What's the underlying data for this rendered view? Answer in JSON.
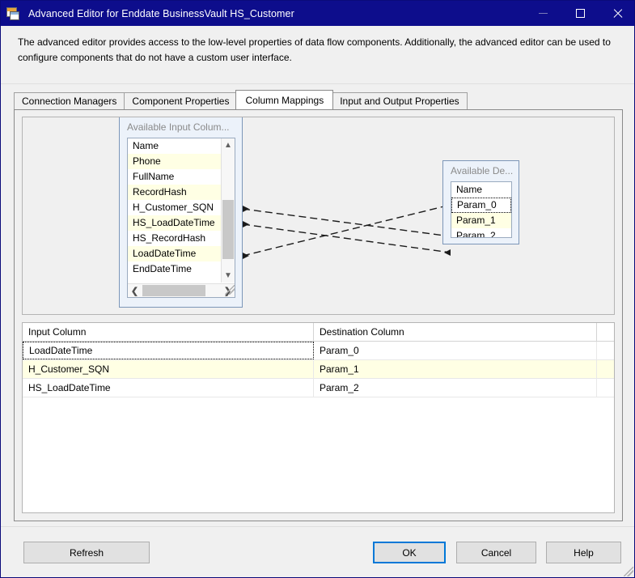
{
  "window": {
    "title": "Advanced Editor for Enddate BusinessVault HS_Customer",
    "icon": "table-component-icon",
    "controls": {
      "minimize": "minimize-icon",
      "maximize": "maximize-icon",
      "close": "close-icon"
    },
    "titlebar_color": "#0d0d8c"
  },
  "description": "The advanced editor provides access to the low-level properties of data flow components. Additionally, the advanced editor can be used to configure components that do not have a custom user interface.",
  "tabs": [
    {
      "label": "Connection Managers",
      "selected": false
    },
    {
      "label": "Component Properties",
      "selected": false
    },
    {
      "label": "Column Mappings",
      "selected": true
    },
    {
      "label": "Input and Output Properties",
      "selected": false
    }
  ],
  "input_list": {
    "title": "Available Input Colum...",
    "header": "Name",
    "items": [
      "Phone",
      "FullName",
      "RecordHash",
      "H_Customer_SQN",
      "HS_LoadDateTime",
      "HS_RecordHash",
      "LoadDateTime",
      "EndDateTime"
    ],
    "vscroll": "vertical-scrollbar",
    "hscroll": "horizontal-scrollbar"
  },
  "destination_list": {
    "title": "Available De...",
    "header": "Name",
    "items": [
      "Param_0",
      "Param_1",
      "Param_2"
    ],
    "focused_item": "Param_0"
  },
  "mappings": [
    {
      "from": "H_Customer_SQN",
      "to": "Param_1"
    },
    {
      "from": "HS_LoadDateTime",
      "to": "Param_2"
    },
    {
      "from": "LoadDateTime",
      "to": "Param_0"
    }
  ],
  "grid": {
    "columns": [
      "Input Column",
      "Destination Column"
    ],
    "rows": [
      {
        "input": "LoadDateTime",
        "destination": "Param_0",
        "focused": true
      },
      {
        "input": "H_Customer_SQN",
        "destination": "Param_1",
        "focused": false
      },
      {
        "input": "HS_LoadDateTime",
        "destination": "Param_2",
        "focused": false
      }
    ]
  },
  "footer": {
    "refresh": "Refresh",
    "ok": "OK",
    "cancel": "Cancel",
    "help": "Help",
    "accent": "#0078d7"
  }
}
